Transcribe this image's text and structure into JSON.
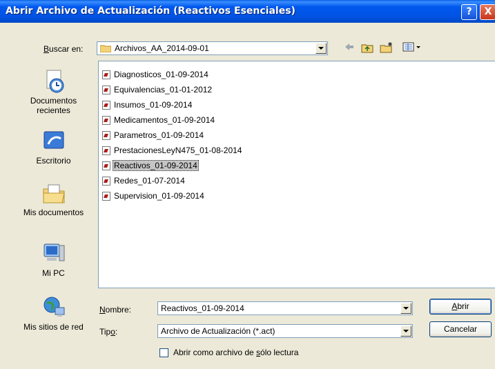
{
  "window": {
    "title": "Abrir Archivo de Actualización (Reactivos Esenciales)",
    "help_label": "?",
    "close_label": "X"
  },
  "lookin": {
    "label_pre": "",
    "label_u": "B",
    "label_post": "uscar en:",
    "value": "Archivos_AA_2014-09-01"
  },
  "toolbar": {
    "back_icon": "back-arrow-icon",
    "up_icon": "up-folder-icon",
    "new_folder_icon": "new-folder-icon",
    "views_icon": "views-menu-icon"
  },
  "places": [
    {
      "label": "Documentos recientes",
      "icon": "recent-documents-icon"
    },
    {
      "label": "Escritorio",
      "icon": "desktop-icon"
    },
    {
      "label": "Mis documentos",
      "icon": "my-documents-icon"
    },
    {
      "label": "Mi PC",
      "icon": "my-computer-icon"
    },
    {
      "label": "Mis sitios de red",
      "icon": "network-places-icon"
    }
  ],
  "files": [
    {
      "name": "Diagnosticos_01-09-2014",
      "selected": false
    },
    {
      "name": "Equivalencias_01-01-2012",
      "selected": false
    },
    {
      "name": "Insumos_01-09-2014",
      "selected": false
    },
    {
      "name": "Medicamentos_01-09-2014",
      "selected": false
    },
    {
      "name": "Parametros_01-09-2014",
      "selected": false
    },
    {
      "name": "PrestacionesLeyN475_01-08-2014",
      "selected": false
    },
    {
      "name": "Reactivos_01-09-2014",
      "selected": true
    },
    {
      "name": "Redes_01-07-2014",
      "selected": false
    },
    {
      "name": "Supervision_01-09-2014",
      "selected": false
    }
  ],
  "filename": {
    "label_u": "N",
    "label_post": "ombre:",
    "value": "Reactivos_01-09-2014"
  },
  "filetype": {
    "label_pre": "Tip",
    "label_u": "o",
    "label_post": ":",
    "value": "Archivo de Actualización (*.act)"
  },
  "readonly": {
    "label_pre": "Abrir como archivo de ",
    "label_u": "s",
    "label_post": "ólo lectura",
    "checked": false
  },
  "buttons": {
    "open_u": "A",
    "open_post": "brir",
    "cancel": "Cancelar"
  }
}
